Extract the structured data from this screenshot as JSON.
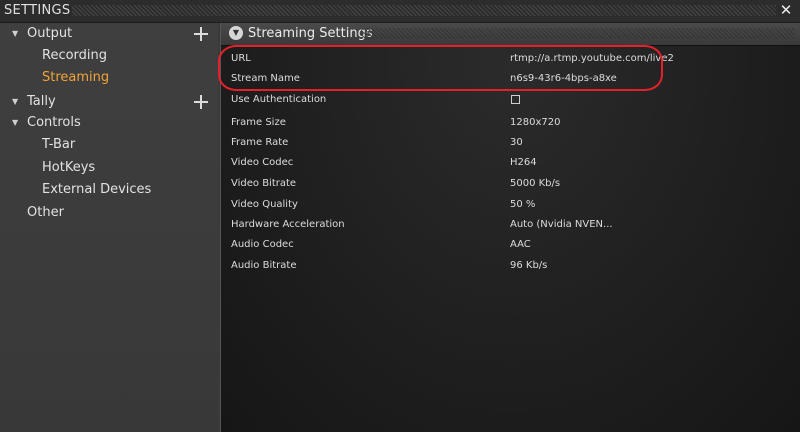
{
  "window": {
    "title": "SETTINGS",
    "close_icon": "close-icon"
  },
  "sidebar": {
    "items": [
      {
        "label": "Output",
        "expanded": true
      },
      {
        "label": "Recording"
      },
      {
        "label": "Streaming",
        "selected": true
      },
      {
        "label": "Tally",
        "expanded": true
      },
      {
        "label": "Controls",
        "expanded": true
      },
      {
        "label": "T-Bar"
      },
      {
        "label": "HotKeys"
      },
      {
        "label": "External Devices"
      },
      {
        "label": "Other"
      }
    ],
    "caret_icon": "caret-down-icon",
    "add_icon": "plus-icon",
    "accent_color": "#f2a33a"
  },
  "panel": {
    "title": "Streaming Settings",
    "collapse_icon": "chevron-down-circle-icon",
    "fields": {
      "url": {
        "label": "URL",
        "value": "rtmp://a.rtmp.youtube.com/live2"
      },
      "stream_name": {
        "label": "Stream Name",
        "value": "n6s9-43r6-4bps-a8xe"
      },
      "use_auth": {
        "label": "Use Authentication",
        "checked": false
      },
      "frame_size": {
        "label": "Frame Size",
        "value": "1280x720"
      },
      "frame_rate": {
        "label": "Frame Rate",
        "value": "30"
      },
      "video_codec": {
        "label": "Video Codec",
        "value": "H264"
      },
      "video_bitrate": {
        "label": "Video Bitrate",
        "value": "5000 Kb/s"
      },
      "video_quality": {
        "label": "Video Quality",
        "value": "50 %"
      },
      "hw_accel": {
        "label": "Hardware Acceleration",
        "value": "Auto (Nvidia NVEN..."
      },
      "audio_codec": {
        "label": "Audio Codec",
        "value": "AAC"
      },
      "audio_bitrate": {
        "label": "Audio Bitrate",
        "value": "96 Kb/s"
      }
    }
  },
  "annotation": {
    "highlight_color": "#e4202a"
  }
}
